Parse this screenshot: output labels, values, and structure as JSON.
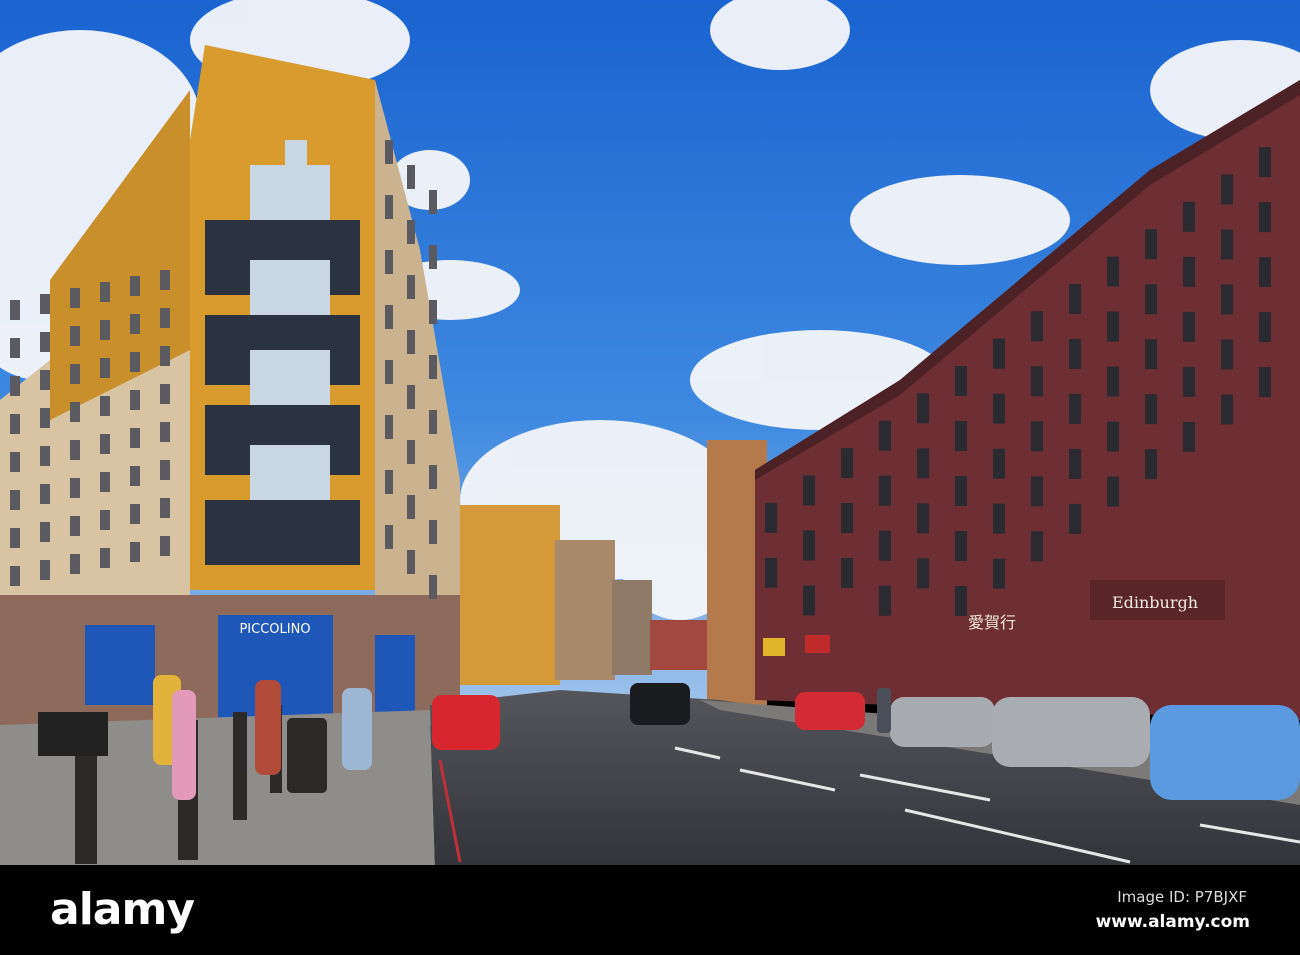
{
  "photo": {
    "signs": {
      "restaurant": "PICCOLINO",
      "shop": "Edinburgh",
      "chinese_shop": "愛賀行"
    },
    "colors": {
      "sky": "#1f6fd6",
      "yellow_facade": "#d99a2e",
      "brick": "#6e2f34",
      "road": "#3d3e44",
      "shopfront_blue": "#1f57b8"
    }
  },
  "watermark": {
    "logo": "alamy",
    "image_id": "Image ID: P7BJXF",
    "url": "www.alamy.com"
  }
}
